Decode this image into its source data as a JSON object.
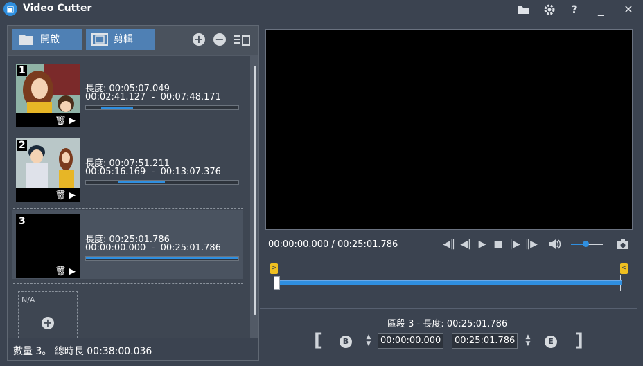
{
  "app": {
    "title": "Video Cutter"
  },
  "toolbar": {
    "open_label": "開啟",
    "cut_label": "剪輯"
  },
  "clips": [
    {
      "number": "1",
      "length_label": "長度",
      "length": "00:05:07.049",
      "start": "00:02:41.127",
      "end": "00:07:48.171",
      "range_sep": "-",
      "progress_start": 0.1,
      "progress_end": 0.31
    },
    {
      "number": "2",
      "length_label": "長度",
      "length": "00:07:51.211",
      "start": "00:05:16.169",
      "end": "00:13:07.376",
      "range_sep": "-",
      "progress_start": 0.21,
      "progress_end": 0.52
    },
    {
      "number": "3",
      "length_label": "長度",
      "length": "00:25:01.786",
      "start": "00:00:00.000",
      "end": "00:25:01.786",
      "range_sep": "-",
      "progress_start": 0.0,
      "progress_end": 1.0
    }
  ],
  "add_slot": {
    "label": "N/A"
  },
  "footer": {
    "summary": "數量 3。 總時長 00:38:00.036"
  },
  "player": {
    "timecode": "00:00:00.000 / 00:25:01.786",
    "volume": 0.5
  },
  "segment": {
    "label": "區段 3 - 長度: 00:25:01.786",
    "start_badge": "B",
    "end_badge": "E",
    "start_time": "00:00:00.000",
    "end_time": "00:25:01.786",
    "start_marker": ">",
    "end_marker": "<"
  },
  "colors": {
    "accent": "#2f8fe0",
    "button": "#4f80b4",
    "marker": "#f0c020"
  }
}
